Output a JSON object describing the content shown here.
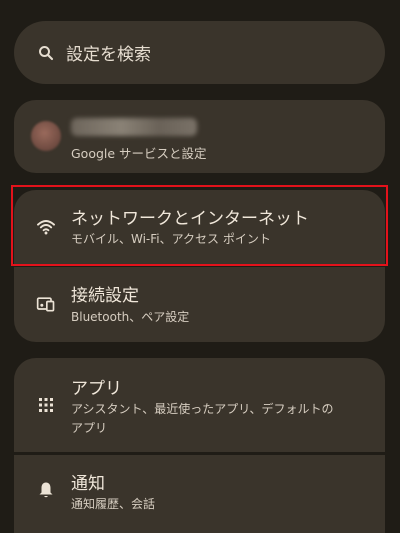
{
  "search": {
    "placeholder": "設定を検索",
    "icon": "search-icon"
  },
  "account": {
    "subtitle": "Google サービスと設定"
  },
  "items": [
    {
      "title": "ネットワークとインターネット",
      "subtitle": "モバイル、Wi-Fi、アクセス ポイント",
      "icon": "wifi-icon"
    },
    {
      "title": "接続設定",
      "subtitle": "Bluetooth、ペア設定",
      "icon": "connected-devices-icon"
    },
    {
      "title": "アプリ",
      "subtitle_line1": "アシスタント、最近使ったアプリ、デフォルトの",
      "subtitle_line2": "アプリ",
      "icon": "apps-grid-icon"
    },
    {
      "title": "通知",
      "subtitle": "通知履歴、会話",
      "icon": "bell-icon"
    }
  ],
  "colors": {
    "background": "#1f1c16",
    "card": "#3a342b",
    "highlight": "#e3121b"
  }
}
